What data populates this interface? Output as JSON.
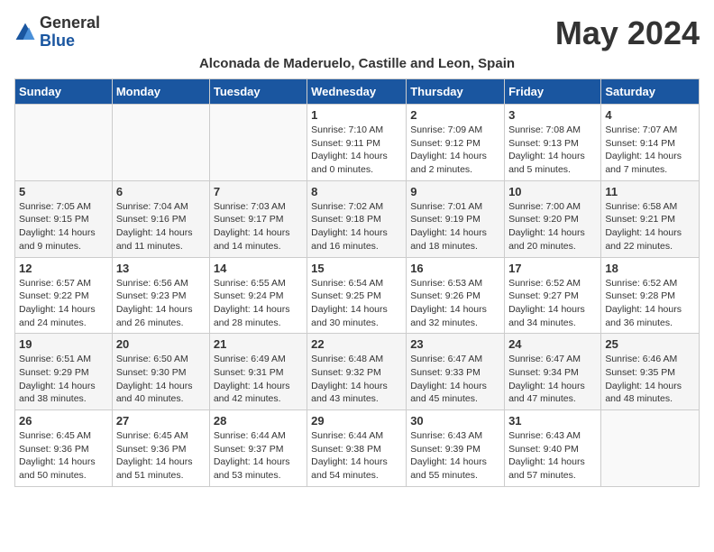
{
  "logo": {
    "general": "General",
    "blue": "Blue"
  },
  "title": "May 2024",
  "subtitle": "Alconada de Maderuelo, Castille and Leon, Spain",
  "headers": [
    "Sunday",
    "Monday",
    "Tuesday",
    "Wednesday",
    "Thursday",
    "Friday",
    "Saturday"
  ],
  "weeks": [
    [
      {
        "day": "",
        "sunrise": "",
        "sunset": "",
        "daylight": ""
      },
      {
        "day": "",
        "sunrise": "",
        "sunset": "",
        "daylight": ""
      },
      {
        "day": "",
        "sunrise": "",
        "sunset": "",
        "daylight": ""
      },
      {
        "day": "1",
        "sunrise": "Sunrise: 7:10 AM",
        "sunset": "Sunset: 9:11 PM",
        "daylight": "Daylight: 14 hours and 0 minutes."
      },
      {
        "day": "2",
        "sunrise": "Sunrise: 7:09 AM",
        "sunset": "Sunset: 9:12 PM",
        "daylight": "Daylight: 14 hours and 2 minutes."
      },
      {
        "day": "3",
        "sunrise": "Sunrise: 7:08 AM",
        "sunset": "Sunset: 9:13 PM",
        "daylight": "Daylight: 14 hours and 5 minutes."
      },
      {
        "day": "4",
        "sunrise": "Sunrise: 7:07 AM",
        "sunset": "Sunset: 9:14 PM",
        "daylight": "Daylight: 14 hours and 7 minutes."
      }
    ],
    [
      {
        "day": "5",
        "sunrise": "Sunrise: 7:05 AM",
        "sunset": "Sunset: 9:15 PM",
        "daylight": "Daylight: 14 hours and 9 minutes."
      },
      {
        "day": "6",
        "sunrise": "Sunrise: 7:04 AM",
        "sunset": "Sunset: 9:16 PM",
        "daylight": "Daylight: 14 hours and 11 minutes."
      },
      {
        "day": "7",
        "sunrise": "Sunrise: 7:03 AM",
        "sunset": "Sunset: 9:17 PM",
        "daylight": "Daylight: 14 hours and 14 minutes."
      },
      {
        "day": "8",
        "sunrise": "Sunrise: 7:02 AM",
        "sunset": "Sunset: 9:18 PM",
        "daylight": "Daylight: 14 hours and 16 minutes."
      },
      {
        "day": "9",
        "sunrise": "Sunrise: 7:01 AM",
        "sunset": "Sunset: 9:19 PM",
        "daylight": "Daylight: 14 hours and 18 minutes."
      },
      {
        "day": "10",
        "sunrise": "Sunrise: 7:00 AM",
        "sunset": "Sunset: 9:20 PM",
        "daylight": "Daylight: 14 hours and 20 minutes."
      },
      {
        "day": "11",
        "sunrise": "Sunrise: 6:58 AM",
        "sunset": "Sunset: 9:21 PM",
        "daylight": "Daylight: 14 hours and 22 minutes."
      }
    ],
    [
      {
        "day": "12",
        "sunrise": "Sunrise: 6:57 AM",
        "sunset": "Sunset: 9:22 PM",
        "daylight": "Daylight: 14 hours and 24 minutes."
      },
      {
        "day": "13",
        "sunrise": "Sunrise: 6:56 AM",
        "sunset": "Sunset: 9:23 PM",
        "daylight": "Daylight: 14 hours and 26 minutes."
      },
      {
        "day": "14",
        "sunrise": "Sunrise: 6:55 AM",
        "sunset": "Sunset: 9:24 PM",
        "daylight": "Daylight: 14 hours and 28 minutes."
      },
      {
        "day": "15",
        "sunrise": "Sunrise: 6:54 AM",
        "sunset": "Sunset: 9:25 PM",
        "daylight": "Daylight: 14 hours and 30 minutes."
      },
      {
        "day": "16",
        "sunrise": "Sunrise: 6:53 AM",
        "sunset": "Sunset: 9:26 PM",
        "daylight": "Daylight: 14 hours and 32 minutes."
      },
      {
        "day": "17",
        "sunrise": "Sunrise: 6:52 AM",
        "sunset": "Sunset: 9:27 PM",
        "daylight": "Daylight: 14 hours and 34 minutes."
      },
      {
        "day": "18",
        "sunrise": "Sunrise: 6:52 AM",
        "sunset": "Sunset: 9:28 PM",
        "daylight": "Daylight: 14 hours and 36 minutes."
      }
    ],
    [
      {
        "day": "19",
        "sunrise": "Sunrise: 6:51 AM",
        "sunset": "Sunset: 9:29 PM",
        "daylight": "Daylight: 14 hours and 38 minutes."
      },
      {
        "day": "20",
        "sunrise": "Sunrise: 6:50 AM",
        "sunset": "Sunset: 9:30 PM",
        "daylight": "Daylight: 14 hours and 40 minutes."
      },
      {
        "day": "21",
        "sunrise": "Sunrise: 6:49 AM",
        "sunset": "Sunset: 9:31 PM",
        "daylight": "Daylight: 14 hours and 42 minutes."
      },
      {
        "day": "22",
        "sunrise": "Sunrise: 6:48 AM",
        "sunset": "Sunset: 9:32 PM",
        "daylight": "Daylight: 14 hours and 43 minutes."
      },
      {
        "day": "23",
        "sunrise": "Sunrise: 6:47 AM",
        "sunset": "Sunset: 9:33 PM",
        "daylight": "Daylight: 14 hours and 45 minutes."
      },
      {
        "day": "24",
        "sunrise": "Sunrise: 6:47 AM",
        "sunset": "Sunset: 9:34 PM",
        "daylight": "Daylight: 14 hours and 47 minutes."
      },
      {
        "day": "25",
        "sunrise": "Sunrise: 6:46 AM",
        "sunset": "Sunset: 9:35 PM",
        "daylight": "Daylight: 14 hours and 48 minutes."
      }
    ],
    [
      {
        "day": "26",
        "sunrise": "Sunrise: 6:45 AM",
        "sunset": "Sunset: 9:36 PM",
        "daylight": "Daylight: 14 hours and 50 minutes."
      },
      {
        "day": "27",
        "sunrise": "Sunrise: 6:45 AM",
        "sunset": "Sunset: 9:36 PM",
        "daylight": "Daylight: 14 hours and 51 minutes."
      },
      {
        "day": "28",
        "sunrise": "Sunrise: 6:44 AM",
        "sunset": "Sunset: 9:37 PM",
        "daylight": "Daylight: 14 hours and 53 minutes."
      },
      {
        "day": "29",
        "sunrise": "Sunrise: 6:44 AM",
        "sunset": "Sunset: 9:38 PM",
        "daylight": "Daylight: 14 hours and 54 minutes."
      },
      {
        "day": "30",
        "sunrise": "Sunrise: 6:43 AM",
        "sunset": "Sunset: 9:39 PM",
        "daylight": "Daylight: 14 hours and 55 minutes."
      },
      {
        "day": "31",
        "sunrise": "Sunrise: 6:43 AM",
        "sunset": "Sunset: 9:40 PM",
        "daylight": "Daylight: 14 hours and 57 minutes."
      },
      {
        "day": "",
        "sunrise": "",
        "sunset": "",
        "daylight": ""
      }
    ]
  ]
}
